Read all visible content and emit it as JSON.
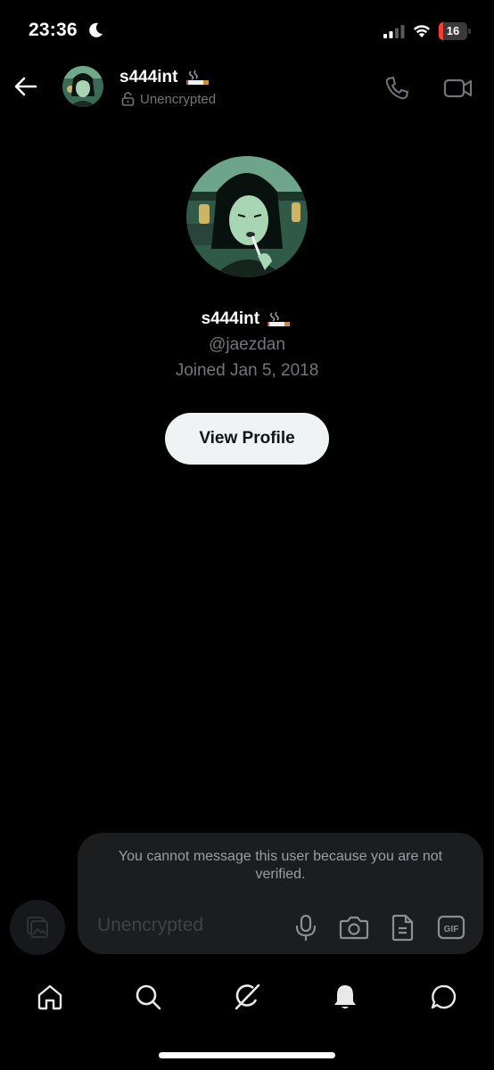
{
  "status_bar": {
    "time": "23:36",
    "battery": "16",
    "battery_level_percent": 16,
    "icons": [
      "moon-icon",
      "signal-icon",
      "wifi-icon",
      "battery-icon"
    ]
  },
  "header": {
    "name": "s444int",
    "status": "Unencrypted",
    "icons": [
      "back-arrow-icon",
      "lock-icon",
      "phone-icon",
      "video-camera-icon",
      "cigarette-emoji"
    ]
  },
  "profile": {
    "name": "s444int",
    "handle": "@jaezdan",
    "joined": "Joined Jan 5, 2018",
    "view_profile_label": "View Profile"
  },
  "composer": {
    "notice": "You cannot message this user because you are not verified.",
    "placeholder": "Unencrypted",
    "gif_label": "GIF",
    "icons": [
      "gallery-icon",
      "microphone-icon",
      "camera-icon",
      "file-icon",
      "gif-icon"
    ]
  },
  "bottom_nav": {
    "items": [
      "home-icon",
      "search-icon",
      "grok-icon",
      "notifications-icon",
      "messages-icon"
    ]
  },
  "colors": {
    "background": "#000000",
    "text_primary": "#ffffff",
    "text_secondary": "#71767b",
    "button_bg": "#eff3f4",
    "composer_bg": "#1c1d1f",
    "battery_low": "#ff3b30"
  }
}
